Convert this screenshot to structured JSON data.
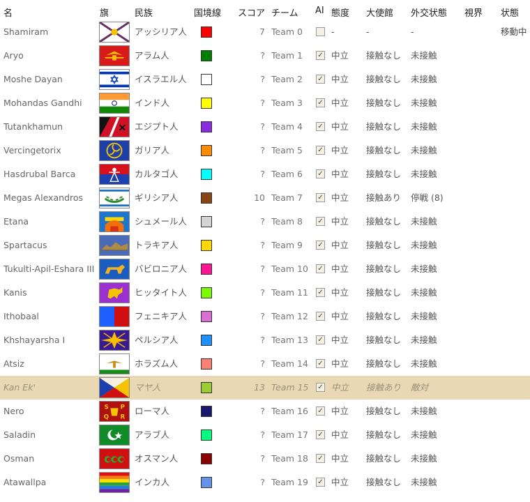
{
  "headers": {
    "name": "名",
    "flag": "旗",
    "nation": "民族",
    "border": "国境線",
    "score": "スコア",
    "team": "チーム",
    "ai": "AI",
    "attitude": "態度",
    "embassy": "大使館",
    "diplomacy": "外交状態",
    "vision": "視界",
    "state": "状態"
  },
  "rows": [
    {
      "name": "Shamiram",
      "flag": "assyria",
      "nation": "アッシリア人",
      "color": "#ff0000",
      "score": "7",
      "team": "Team 0",
      "ai": false,
      "attitude": "-",
      "embassy": "-",
      "diplomacy": "-",
      "state": "移動中"
    },
    {
      "name": "Aryo",
      "flag": "aryan",
      "nation": "アラム人",
      "color": "#008000",
      "score": "?",
      "team": "Team 1",
      "ai": true,
      "attitude": "中立",
      "embassy": "接触なし",
      "diplomacy": "未接触",
      "state": ""
    },
    {
      "name": "Moshe Dayan",
      "flag": "israel",
      "nation": "イスラエル人",
      "color": "#ffffff",
      "score": "?",
      "team": "Team 2",
      "ai": true,
      "attitude": "中立",
      "embassy": "接触なし",
      "diplomacy": "未接触",
      "state": ""
    },
    {
      "name": "Mohandas Gandhi",
      "flag": "india",
      "nation": "インド人",
      "color": "#ffff00",
      "score": "?",
      "team": "Team 3",
      "ai": true,
      "attitude": "中立",
      "embassy": "接触なし",
      "diplomacy": "未接触",
      "state": ""
    },
    {
      "name": "Tutankhamun",
      "flag": "egypt",
      "nation": "エジプト人",
      "color": "#8a2be2",
      "score": "?",
      "team": "Team 4",
      "ai": true,
      "attitude": "中立",
      "embassy": "接触なし",
      "diplomacy": "未接触",
      "state": ""
    },
    {
      "name": "Vercingetorix",
      "flag": "gaul",
      "nation": "ガリア人",
      "color": "#ff8c00",
      "score": "?",
      "team": "Team 5",
      "ai": true,
      "attitude": "中立",
      "embassy": "接触なし",
      "diplomacy": "未接触",
      "state": ""
    },
    {
      "name": "Hasdrubal Barca",
      "flag": "carthage",
      "nation": "カルタゴ人",
      "color": "#00ffff",
      "score": "?",
      "team": "Team 6",
      "ai": true,
      "attitude": "中立",
      "embassy": "接触なし",
      "diplomacy": "未接触",
      "state": ""
    },
    {
      "name": "Megas Alexandros",
      "flag": "greece",
      "nation": "ギリシア人",
      "color": "#8b4513",
      "score": "10",
      "team": "Team 7",
      "ai": true,
      "attitude": "中立",
      "embassy": "接触あり",
      "diplomacy": "停戦 (8)",
      "state": ""
    },
    {
      "name": "Etana",
      "flag": "sumer",
      "nation": "シュメール人",
      "color": "#d3d3d3",
      "score": "?",
      "team": "Team 8",
      "ai": true,
      "attitude": "中立",
      "embassy": "接触なし",
      "diplomacy": "未接触",
      "state": ""
    },
    {
      "name": "Spartacus",
      "flag": "thrace",
      "nation": "トラキア人",
      "color": "#ffd700",
      "score": "?",
      "team": "Team 9",
      "ai": true,
      "attitude": "中立",
      "embassy": "接触なし",
      "diplomacy": "未接触",
      "state": ""
    },
    {
      "name": "Tukulti-Apil-Eshara III",
      "flag": "babylon",
      "nation": "バビロニア人",
      "color": "#ff1493",
      "score": "?",
      "team": "Team 10",
      "ai": true,
      "attitude": "中立",
      "embassy": "接触なし",
      "diplomacy": "未接触",
      "state": ""
    },
    {
      "name": "Kanis",
      "flag": "hittite",
      "nation": "ヒッタイト人",
      "color": "#7cfc00",
      "score": "?",
      "team": "Team 11",
      "ai": true,
      "attitude": "中立",
      "embassy": "接触なし",
      "diplomacy": "未接触",
      "state": ""
    },
    {
      "name": "Ithobaal",
      "flag": "phoenicia",
      "nation": "フェニキア人",
      "color": "#da70d6",
      "score": "?",
      "team": "Team 12",
      "ai": true,
      "attitude": "中立",
      "embassy": "接触なし",
      "diplomacy": "未接触",
      "state": ""
    },
    {
      "name": "Khshayarsha I",
      "flag": "persia",
      "nation": "ペルシア人",
      "color": "#1e90ff",
      "score": "?",
      "team": "Team 13",
      "ai": true,
      "attitude": "中立",
      "embassy": "接触なし",
      "diplomacy": "未接触",
      "state": ""
    },
    {
      "name": "Atsiz",
      "flag": "khwarezm",
      "nation": "ホラズム人",
      "color": "#fa8072",
      "score": "?",
      "team": "Team 14",
      "ai": true,
      "attitude": "中立",
      "embassy": "接触なし",
      "diplomacy": "未接触",
      "state": ""
    },
    {
      "name": "Kan Ek'",
      "flag": "maya",
      "nation": "マヤ人",
      "color": "#9acd32",
      "score": "13",
      "team": "Team 15",
      "ai": true,
      "attitude": "中立",
      "embassy": "接触あり",
      "diplomacy": "敵対",
      "state": "",
      "selected": true
    },
    {
      "name": "Nero",
      "flag": "rome",
      "nation": "ローマ人",
      "color": "#191970",
      "score": "?",
      "team": "Team 16",
      "ai": true,
      "attitude": "中立",
      "embassy": "接触なし",
      "diplomacy": "未接触",
      "state": ""
    },
    {
      "name": "Saladin",
      "flag": "arab",
      "nation": "アラブ人",
      "color": "#00ff7f",
      "score": "?",
      "team": "Team 17",
      "ai": true,
      "attitude": "中立",
      "embassy": "接触なし",
      "diplomacy": "未接触",
      "state": ""
    },
    {
      "name": "Osman",
      "flag": "ottoman",
      "nation": "オスマン人",
      "color": "#8b0000",
      "score": "?",
      "team": "Team 18",
      "ai": true,
      "attitude": "中立",
      "embassy": "接触なし",
      "diplomacy": "未接触",
      "state": ""
    },
    {
      "name": "Atawallpa",
      "flag": "inca",
      "nation": "インカ人",
      "color": "#6495ed",
      "score": "?",
      "team": "Team 19",
      "ai": true,
      "attitude": "中立",
      "embassy": "接触なし",
      "diplomacy": "未接触",
      "state": ""
    }
  ]
}
